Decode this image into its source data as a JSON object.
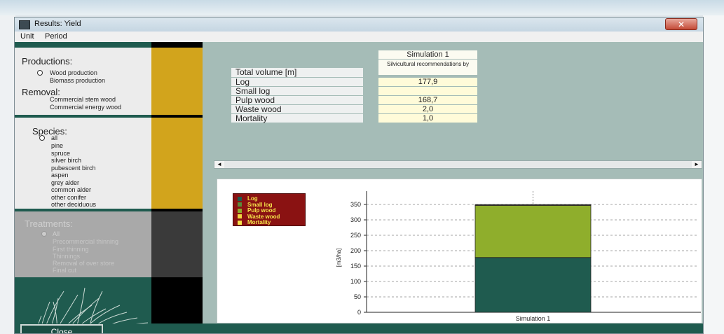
{
  "window": {
    "title": "Results: Yield",
    "close_glyph": "✕"
  },
  "menu": [
    "Unit",
    "Period"
  ],
  "left_panel": {
    "productions_title": "Productions:",
    "productions": [
      "Wood production",
      "Biomass production"
    ],
    "removal_title": "Removal:",
    "removal": [
      "Commercial stem wood",
      "Commercial energy wood"
    ],
    "species_title": "Species:",
    "species": [
      "all",
      "pine",
      "spruce",
      "silver birch",
      "pubescent birch",
      "aspen",
      "grey alder",
      "common alder",
      "other conifer",
      "other deciduous"
    ],
    "treatments_title": "Treatments:",
    "treatments": [
      "All",
      "Precommercial thinning",
      "First thinning",
      "Thinnings",
      "Removal of over store",
      "Final cut"
    ]
  },
  "table": {
    "column_header": "Simulation 1",
    "column_subheader": "Silvicultural recommendations by",
    "header_label": "Total volume [m]",
    "rows": [
      {
        "label": "Log",
        "value": "177,9"
      },
      {
        "label": "Small log",
        "value": ""
      },
      {
        "label": "Pulp wood",
        "value": "168,7"
      },
      {
        "label": "Waste wood",
        "value": "2,0"
      },
      {
        "label": "Mortality",
        "value": "1,0"
      }
    ]
  },
  "scrollbar": {
    "left_glyph": "◄",
    "right_glyph": "►"
  },
  "chart_data": {
    "type": "bar",
    "stacked": true,
    "categories": [
      "Simulation 1"
    ],
    "series": [
      {
        "name": "Log",
        "values": [
          177.9
        ],
        "color": "#1f5b4f"
      },
      {
        "name": "Small log",
        "values": [
          0
        ],
        "color": "#5a8a3a"
      },
      {
        "name": "Pulp wood",
        "values": [
          168.7
        ],
        "color": "#8fae2c"
      },
      {
        "name": "Waste wood",
        "values": [
          2.0
        ],
        "color": "#f2d740"
      },
      {
        "name": "Mortality",
        "values": [
          1.0
        ],
        "color": "#f6e44a"
      }
    ],
    "ylabel": "[m3/ha]",
    "yticks": [
      0,
      50,
      100,
      150,
      200,
      250,
      300,
      350
    ],
    "ylim": [
      0,
      375
    ],
    "grid": true,
    "legend_position": "top-left"
  },
  "footer": {
    "close_label": "Close"
  },
  "colors": {
    "dark_green": "#1f5b4f",
    "mustard": "#d2a41c",
    "bg_teal": "#a5bcb7"
  }
}
